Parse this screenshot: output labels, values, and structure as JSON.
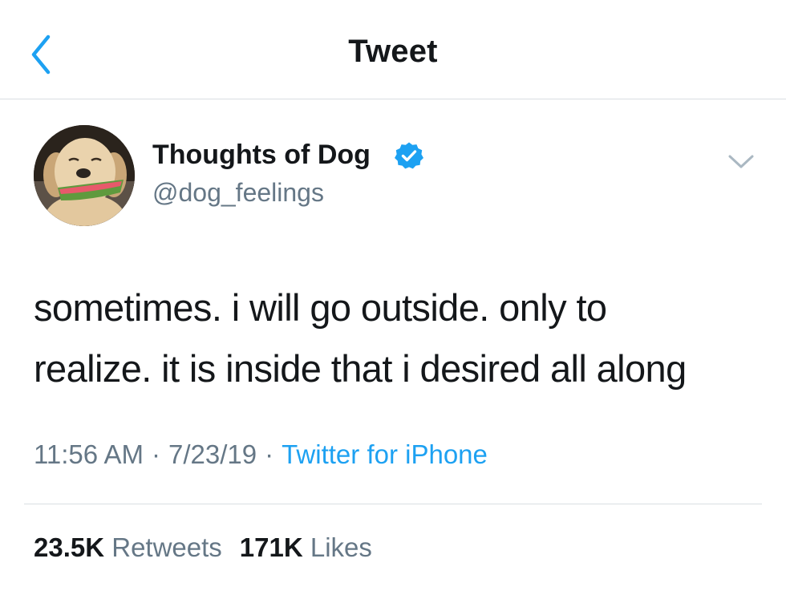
{
  "header": {
    "title": "Tweet",
    "back_icon": "chevron-left-icon"
  },
  "author": {
    "display_name": "Thoughts of Dog",
    "handle": "@dog_feelings",
    "verified": true,
    "verified_icon": "verified-badge-icon",
    "avatar_icon": "avatar-dog-photo"
  },
  "menu": {
    "icon": "chevron-down-icon"
  },
  "tweet": {
    "line1": "sometimes. i will go outside. only to",
    "line2": "realize. it is inside that i desired all along"
  },
  "meta": {
    "time": "11:56 AM",
    "separator": "·",
    "date": "7/23/19",
    "source": "Twitter for iPhone"
  },
  "stats": {
    "retweets_count": "23.5K",
    "retweets_label": "Retweets",
    "likes_count": "171K",
    "likes_label": "Likes"
  },
  "colors": {
    "accent": "#1da1f2",
    "text": "#14171a",
    "secondary": "#657786",
    "divider": "#d9dee2"
  }
}
